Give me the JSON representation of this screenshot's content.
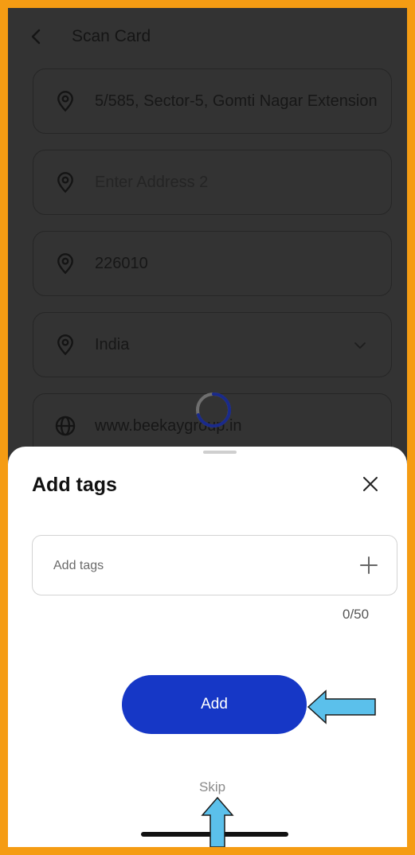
{
  "header": {
    "title": "Scan Card"
  },
  "form": {
    "address1": "5/585, Sector-5, Gomti Nagar Extension",
    "address2_placeholder": "Enter Address 2",
    "pincode": "226010",
    "country": "India",
    "website": "www.beekaygroup.in"
  },
  "sheet": {
    "title": "Add tags",
    "input_placeholder": "Add tags",
    "counter": "0/50",
    "add_label": "Add",
    "skip_label": "Skip"
  },
  "colors": {
    "border_frame": "#f59c13",
    "primary_button": "#1637c6",
    "annotation_arrow": "#5bc0eb"
  }
}
